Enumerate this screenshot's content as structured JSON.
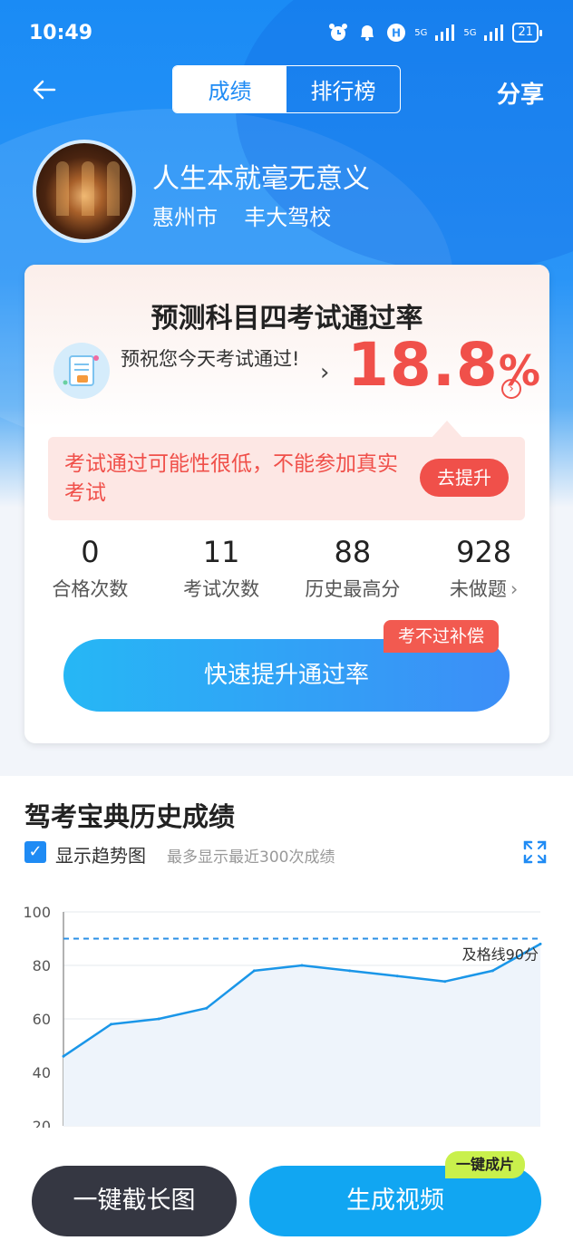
{
  "status_bar": {
    "time": "10:49",
    "network": "5G",
    "battery": "21"
  },
  "nav": {
    "tabs": [
      "成绩",
      "排行榜"
    ],
    "active_tab": 0,
    "share": "分享"
  },
  "profile": {
    "name": "人生本就毫无意义",
    "city": "惠州市",
    "school": "丰大驾校"
  },
  "prediction": {
    "title": "预测科目四考试通过率",
    "wish": "预祝您今天考试通过!",
    "rate": "18.8",
    "rate_unit": "%",
    "warning": "考试通过可能性很低，不能参加真实考试",
    "improve_button": "去提升"
  },
  "stats": [
    {
      "value": "0",
      "label": "合格次数"
    },
    {
      "value": "11",
      "label": "考试次数"
    },
    {
      "value": "88",
      "label": "历史最高分"
    },
    {
      "value": "928",
      "label": "未做题"
    }
  ],
  "compensation_badge": "考不过补偿",
  "fast_improve_button": "快速提升通过率",
  "history": {
    "title": "驾考宝典历史成绩",
    "show_trend": "显示趋势图",
    "note": "最多显示最近300次成绩"
  },
  "chart_data": {
    "type": "line",
    "y_ticks": [
      "100",
      "80",
      "60",
      "40",
      "20"
    ],
    "ylim": [
      20,
      100
    ],
    "pass_line": {
      "value": 90,
      "label": "及格线90分"
    },
    "values": [
      46,
      58,
      60,
      64,
      78,
      80,
      78,
      76,
      74,
      78,
      88
    ],
    "colors": {
      "line": "#1a96e8",
      "fill": "#eef4fb",
      "pass_line": "#2a8fe6"
    }
  },
  "bottom": {
    "screenshot_button": "一键截长图",
    "video_button": "生成视频",
    "one_click_badge": "一键成片"
  },
  "colors": {
    "primary": "#1f8bf4",
    "danger": "#f0504a",
    "dark": "#353742"
  }
}
